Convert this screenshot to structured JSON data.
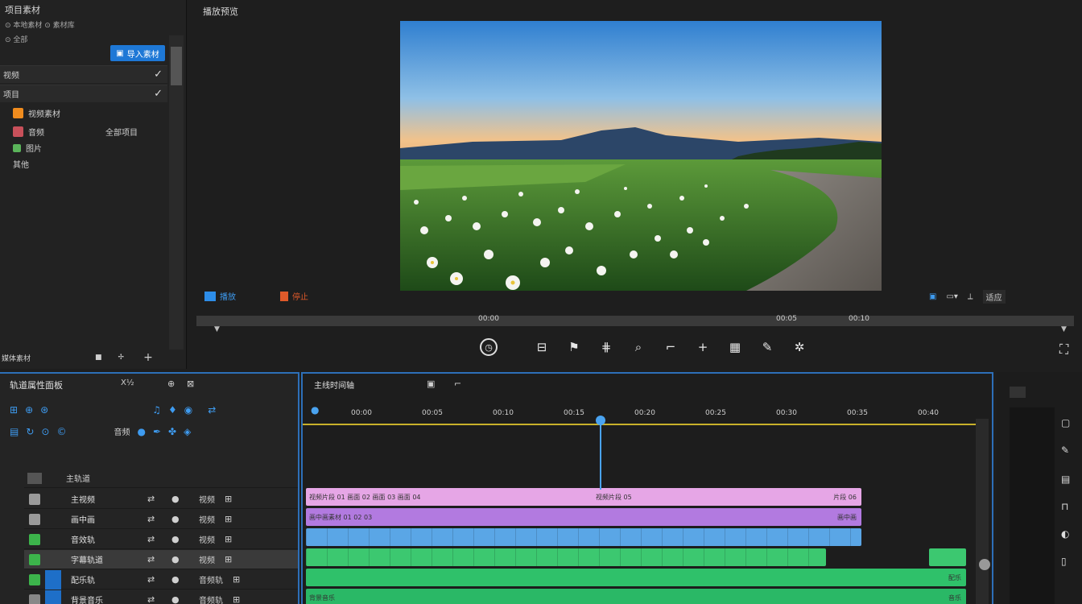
{
  "project": {
    "title": "项目素材",
    "sub1": "⊙ 本地素材 ⊙ 素材库",
    "sub2": "⊙ 全部",
    "import_label": "导入素材",
    "section1": "视频",
    "section2": "项目",
    "items": [
      {
        "label": "视频素材",
        "color": "#f08c1e"
      },
      {
        "label": "音频",
        "extra": "全部项目",
        "color": "#c8505a"
      },
      {
        "label": "图片",
        "color": "#5ab45a"
      },
      {
        "label": "其他",
        "color": "#888888"
      }
    ],
    "footer": "媒体素材"
  },
  "preview": {
    "title": "播放预览",
    "left_buttons": [
      "播放",
      "停止"
    ],
    "right_buttons": [
      "适应"
    ],
    "ruler_labels": [
      "00:00",
      "00:05",
      "00:10"
    ],
    "tool_icons": [
      "clock-icon",
      "crop-icon",
      "mark-icon",
      "split-icon",
      "zoom-icon",
      "trim-icon",
      "add-icon",
      "snapshot-icon",
      "magic-icon",
      "settings-icon"
    ]
  },
  "tracks": {
    "title": "轨道属性面板",
    "zoom": "X½",
    "group_label": "主轨道",
    "row3_label": "音频",
    "rows": [
      {
        "name": "主视频",
        "sub": "视频",
        "color": "#9a9a9a"
      },
      {
        "name": "画中画",
        "sub": "视频",
        "color": "#9a9a9a"
      },
      {
        "name": "音效轨",
        "sub": "视频",
        "color": "#3cb44b"
      },
      {
        "name": "字幕轨道",
        "sub": "视频",
        "color": "#3cb44b"
      },
      {
        "name": "配乐轨",
        "sub": "音频轨",
        "color": "#3cb44b"
      },
      {
        "name": "背景音乐",
        "sub": "音频轨",
        "color": "#888888"
      }
    ]
  },
  "timeline": {
    "title": "主线时间轴",
    "time_labels": [
      "00:00",
      "00:05",
      "00:10",
      "00:15",
      "00:20",
      "00:25",
      "00:30",
      "00:35",
      "00:40"
    ],
    "clips": [
      {
        "label": "视频片段 01 画面 02 画面 03 画面 04",
        "mid": "视频片段 05",
        "end": "片段 06",
        "color": "#e6a6e6"
      },
      {
        "label": "画中画素材 01 02 03",
        "end": "画中画",
        "color": "#b27ae0"
      },
      {
        "label": "",
        "color": "#5aa6e6"
      },
      {
        "label": "",
        "color": "#3cc870"
      },
      {
        "label": "",
        "end": "配乐",
        "color": "#2fc16a"
      },
      {
        "label": "背景音乐",
        "end": "音乐",
        "color": "#2ab866"
      }
    ]
  }
}
